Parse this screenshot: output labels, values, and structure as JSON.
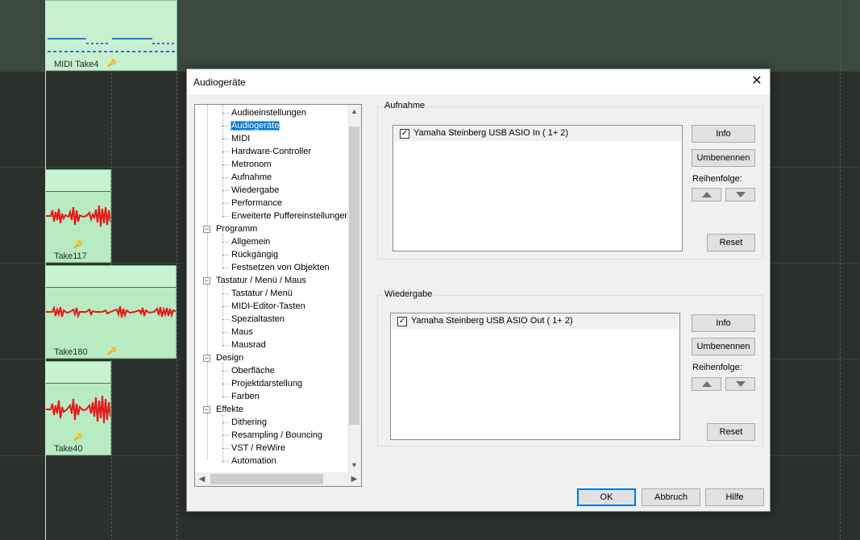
{
  "daw": {
    "clips": [
      {
        "name": "MIDI Take4"
      },
      {
        "name": "Take117"
      },
      {
        "name": "Take180"
      },
      {
        "name": "Take40"
      }
    ]
  },
  "dialog": {
    "title": "Audiogeräte",
    "close_glyph": "✕",
    "tree": {
      "rows": [
        {
          "label": "Audioeinstellungen"
        },
        {
          "label": "Audiogeräte",
          "selected": true
        },
        {
          "label": "MIDI"
        },
        {
          "label": "Hardware-Controller"
        },
        {
          "label": "Metronom"
        },
        {
          "label": "Aufnahme"
        },
        {
          "label": "Wiedergabe"
        },
        {
          "label": "Performance"
        },
        {
          "label": "Erweiterte Puffereinstellungen"
        },
        {
          "label": "Programm",
          "parent": true
        },
        {
          "label": "Allgemein"
        },
        {
          "label": "Rückgängig"
        },
        {
          "label": "Festsetzen von Objekten"
        },
        {
          "label": "Tastatur / Menü / Maus",
          "parent": true
        },
        {
          "label": "Tastatur / Menü"
        },
        {
          "label": "MIDI-Editor-Tasten"
        },
        {
          "label": "Spezialtasten"
        },
        {
          "label": "Maus"
        },
        {
          "label": "Mausrad"
        },
        {
          "label": "Design",
          "parent": true
        },
        {
          "label": "Oberfläche"
        },
        {
          "label": "Projektdarstellung"
        },
        {
          "label": "Farben"
        },
        {
          "label": "Effekte",
          "parent": true
        },
        {
          "label": "Dithering"
        },
        {
          "label": "Resampling / Bouncing"
        },
        {
          "label": "VST / ReWire"
        },
        {
          "label": "Automation"
        }
      ],
      "expander_glyph": "−"
    },
    "recording": {
      "label": "Aufnahme",
      "device": "Yamaha Steinberg USB ASIO In ( 1+ 2)",
      "checked_glyph": "✓",
      "info_button": "Info",
      "rename_button": "Umbenennen",
      "order_label": "Reihenfolge:",
      "reset_button": "Reset"
    },
    "playback": {
      "label": "Wiedergabe",
      "device": "Yamaha Steinberg USB ASIO Out ( 1+ 2)",
      "checked_glyph": "✓",
      "info_button": "Info",
      "rename_button": "Umbenennen",
      "order_label": "Reihenfolge:",
      "reset_button": "Reset"
    },
    "buttons": {
      "ok": "OK",
      "cancel": "Abbruch",
      "help": "Hilfe"
    }
  }
}
